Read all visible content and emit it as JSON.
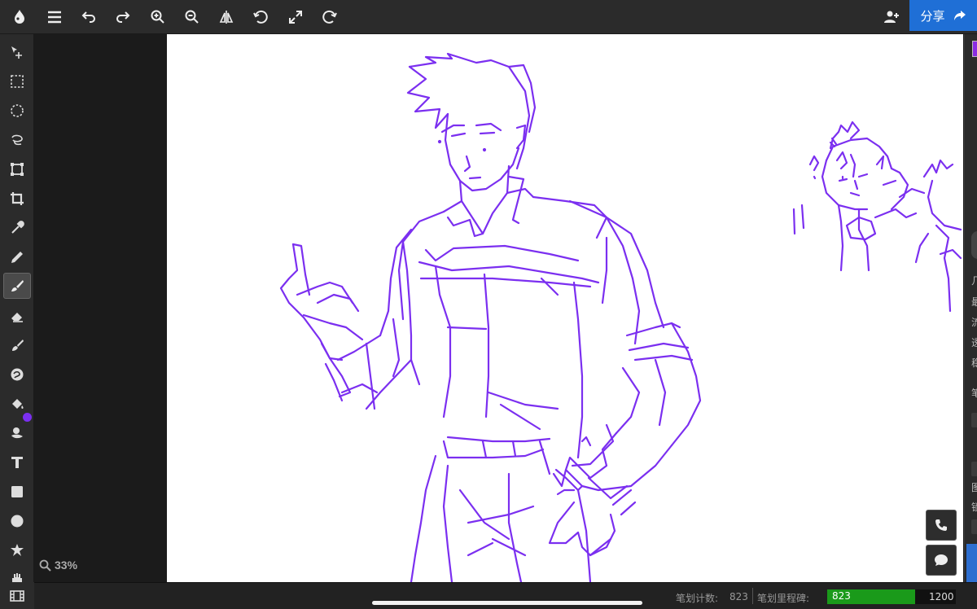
{
  "app": {
    "accent_color": "#1f6fd6",
    "brush_color": "#7b2ff0"
  },
  "topbar": {
    "icons": [
      "app-logo-icon",
      "menu-icon",
      "undo-icon",
      "redo-icon",
      "zoom-in-icon",
      "zoom-out-icon",
      "flip-icon",
      "rotate-icon",
      "fullscreen-icon",
      "reset-rotate-icon"
    ],
    "add_user_icon": "add-user-icon",
    "share_label": "分享",
    "share_icon": "share-arrow-icon"
  },
  "tools": [
    {
      "name": "move",
      "icon": "move-icon"
    },
    {
      "name": "rect-select",
      "icon": "rect-select-icon"
    },
    {
      "name": "ellipse-select",
      "icon": "ellipse-select-icon"
    },
    {
      "name": "lasso-select",
      "icon": "lasso-icon"
    },
    {
      "name": "transform",
      "icon": "transform-icon"
    },
    {
      "name": "crop",
      "icon": "crop-icon"
    },
    {
      "name": "eyedropper",
      "icon": "eyedropper-icon"
    },
    {
      "name": "pencil",
      "icon": "pencil-icon"
    },
    {
      "name": "brush",
      "icon": "brush-icon",
      "active": true
    },
    {
      "name": "eraser",
      "icon": "eraser-icon"
    },
    {
      "name": "smudge",
      "icon": "smudge-icon"
    },
    {
      "name": "blend",
      "icon": "blend-icon"
    },
    {
      "name": "fill",
      "icon": "paint-bucket-icon"
    },
    {
      "name": "gradient",
      "icon": "gradient-icon"
    },
    {
      "name": "text",
      "icon": "text-icon"
    },
    {
      "name": "rectangle",
      "icon": "rectangle-icon"
    },
    {
      "name": "ellipse",
      "icon": "ellipse-icon"
    },
    {
      "name": "shape",
      "icon": "shape-icon"
    },
    {
      "name": "hand",
      "icon": "hand-icon"
    }
  ],
  "zoom": {
    "label": "33%",
    "icon": "magnifier-icon"
  },
  "right_panel": {
    "labels": [
      "几",
      "最",
      "流",
      "透",
      "稳",
      "笔",
      "图",
      "锁"
    ]
  },
  "float_buttons": {
    "call_icon": "phone-icon",
    "chat_icon": "chat-icon"
  },
  "status": {
    "stroke_count_label": "笔划计数:",
    "stroke_count_value": "823",
    "milestone_label": "笔划里程碑:",
    "progress_value": "823",
    "progress_max": "1200",
    "progress_fraction": 0.686
  }
}
